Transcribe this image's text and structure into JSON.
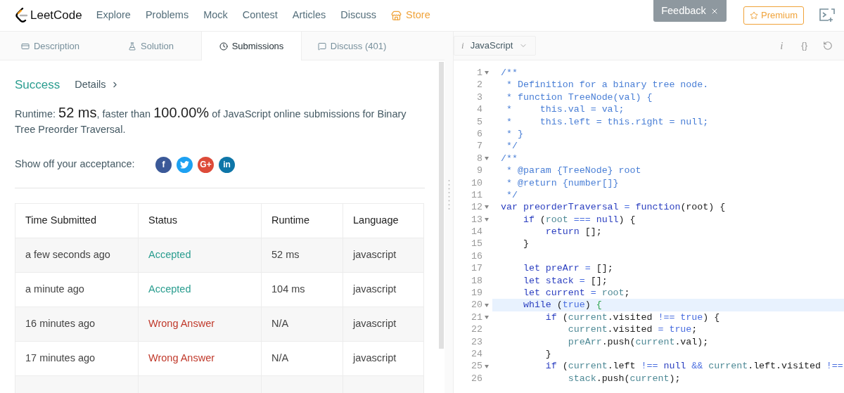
{
  "nav": {
    "logo": "LeetCode",
    "links": [
      {
        "label": "Explore",
        "kind": "link"
      },
      {
        "label": "Problems",
        "kind": "link"
      },
      {
        "label": "Mock",
        "kind": "link"
      },
      {
        "label": "Contest",
        "kind": "link"
      },
      {
        "label": "Articles",
        "kind": "link"
      },
      {
        "label": "Discuss",
        "kind": "link"
      },
      {
        "label": "Store",
        "kind": "store"
      }
    ],
    "feedback": "Feedback",
    "premium": "Premium"
  },
  "tabs": [
    {
      "label": "Description",
      "selected": false
    },
    {
      "label": "Solution",
      "selected": false
    },
    {
      "label": "Submissions",
      "selected": true
    },
    {
      "label": "Discuss (401)",
      "selected": false
    }
  ],
  "result": {
    "status": "Success",
    "details": "Details",
    "summary": [
      {
        "text": "Runtime: ",
        "big": false
      },
      {
        "text": "52 ms",
        "big": true
      },
      {
        "text": ", faster than ",
        "big": false
      },
      {
        "text": "100.00%",
        "big": true
      },
      {
        "text": " of JavaScript online submissions for Binary Tree Preorder Traversal.",
        "big": false
      }
    ],
    "share_label": "Show off your acceptance:",
    "share_buttons": [
      {
        "kind": "facebook",
        "glyph": "f"
      },
      {
        "kind": "twitter"
      },
      {
        "kind": "google",
        "glyph": "G+"
      },
      {
        "kind": "linkedin",
        "glyph": "in"
      }
    ]
  },
  "table": {
    "columns": [
      "Time Submitted",
      "Status",
      "Runtime",
      "Language"
    ],
    "rows": [
      {
        "time": "a few seconds ago",
        "status": "Accepted",
        "kind": "accepted",
        "runtime": "52 ms",
        "language": "javascript"
      },
      {
        "time": "a minute ago",
        "status": "Accepted",
        "kind": "accepted",
        "runtime": "104 ms",
        "language": "javascript"
      },
      {
        "time": "16 minutes ago",
        "status": "Wrong Answer",
        "kind": "wrong",
        "runtime": "N/A",
        "language": "javascript"
      },
      {
        "time": "17 minutes ago",
        "status": "Wrong Answer",
        "kind": "wrong",
        "runtime": "N/A",
        "language": "javascript"
      }
    ]
  },
  "editor": {
    "language_glyph": "i",
    "language": "JavaScript",
    "toolbar": [
      {
        "kind": "info",
        "glyph": "i"
      },
      {
        "kind": "braces",
        "glyph": "{}"
      },
      {
        "kind": "reset"
      }
    ],
    "lines": [
      {
        "n": "1",
        "fold": true,
        "active": false,
        "tokens": [
          {
            "kind": "comment",
            "t": "/**"
          }
        ]
      },
      {
        "n": "2",
        "fold": false,
        "active": false,
        "tokens": [
          {
            "kind": "comment",
            "t": " * Definition for a binary tree node."
          }
        ]
      },
      {
        "n": "3",
        "fold": false,
        "active": false,
        "tokens": [
          {
            "kind": "comment",
            "t": " * function TreeNode(val) {"
          }
        ]
      },
      {
        "n": "4",
        "fold": false,
        "active": false,
        "tokens": [
          {
            "kind": "comment",
            "t": " *     this.val = val;"
          }
        ]
      },
      {
        "n": "5",
        "fold": false,
        "active": false,
        "tokens": [
          {
            "kind": "comment",
            "t": " *     this.left = this.right = null;"
          }
        ]
      },
      {
        "n": "6",
        "fold": false,
        "active": false,
        "tokens": [
          {
            "kind": "comment",
            "t": " * }"
          }
        ]
      },
      {
        "n": "7",
        "fold": false,
        "active": false,
        "tokens": [
          {
            "kind": "comment",
            "t": " */"
          }
        ]
      },
      {
        "n": "8",
        "fold": true,
        "active": false,
        "tokens": [
          {
            "kind": "comment",
            "t": "/**"
          }
        ]
      },
      {
        "n": "9",
        "fold": false,
        "active": false,
        "tokens": [
          {
            "kind": "comment",
            "t": " * @param {TreeNode} root"
          }
        ]
      },
      {
        "n": "10",
        "fold": false,
        "active": false,
        "tokens": [
          {
            "kind": "comment",
            "t": " * @return {number[]}"
          }
        ]
      },
      {
        "n": "11",
        "fold": false,
        "active": false,
        "tokens": [
          {
            "kind": "comment",
            "t": " */"
          }
        ]
      },
      {
        "n": "12",
        "fold": true,
        "active": false,
        "tokens": [
          {
            "kind": "keyword",
            "t": "var preorderTraversal"
          },
          {
            "kind": "operator",
            "t": " ="
          },
          {
            "kind": "keyword",
            "t": " function"
          },
          {
            "kind": "plain",
            "t": "(root) {"
          }
        ]
      },
      {
        "n": "13",
        "fold": true,
        "active": false,
        "tokens": [
          {
            "kind": "keyword",
            "t": "    if"
          },
          {
            "kind": "plain",
            "t": " ("
          },
          {
            "kind": "variable",
            "t": "root"
          },
          {
            "kind": "operator",
            "t": " ==="
          },
          {
            "kind": "keyword",
            "t": " null"
          },
          {
            "kind": "plain",
            "t": ") {"
          }
        ]
      },
      {
        "n": "14",
        "fold": false,
        "active": false,
        "tokens": [
          {
            "kind": "keyword",
            "t": "        return"
          },
          {
            "kind": "plain",
            "t": " [];"
          }
        ]
      },
      {
        "n": "15",
        "fold": false,
        "active": false,
        "tokens": [
          {
            "kind": "plain",
            "t": "    }"
          }
        ]
      },
      {
        "n": "16",
        "fold": false,
        "active": false
      },
      {
        "n": "17",
        "fold": false,
        "active": false,
        "tokens": [
          {
            "kind": "keyword",
            "t": "    let preArr"
          },
          {
            "kind": "operator",
            "t": " ="
          },
          {
            "kind": "plain",
            "t": " [];"
          }
        ]
      },
      {
        "n": "18",
        "fold": false,
        "active": false,
        "tokens": [
          {
            "kind": "keyword",
            "t": "    let stack"
          },
          {
            "kind": "operator",
            "t": " ="
          },
          {
            "kind": "plain",
            "t": " [];"
          }
        ]
      },
      {
        "n": "19",
        "fold": false,
        "active": false,
        "tokens": [
          {
            "kind": "keyword",
            "t": "    let current"
          },
          {
            "kind": "operator",
            "t": " ="
          },
          {
            "kind": "variable",
            "t": " root"
          },
          {
            "kind": "plain",
            "t": ";"
          }
        ]
      },
      {
        "n": "20",
        "fold": true,
        "active": true,
        "tokens": [
          {
            "kind": "keyword",
            "t": "    while"
          },
          {
            "kind": "plain",
            "t": " ("
          },
          {
            "kind": "operator",
            "t": "true"
          },
          {
            "kind": "plain",
            "t": ") "
          },
          {
            "kind": "bracket",
            "t": "{"
          }
        ]
      },
      {
        "n": "21",
        "fold": true,
        "active": false,
        "tokens": [
          {
            "kind": "keyword",
            "t": "        if"
          },
          {
            "kind": "plain",
            "t": " ("
          },
          {
            "kind": "variable",
            "t": "current"
          },
          {
            "kind": "plain",
            "t": ".visited"
          },
          {
            "kind": "operator",
            "t": " !=="
          },
          {
            "kind": "operator",
            "t": " true"
          },
          {
            "kind": "plain",
            "t": ") {"
          }
        ]
      },
      {
        "n": "22",
        "fold": false,
        "active": false,
        "tokens": [
          {
            "kind": "variable",
            "t": "            current"
          },
          {
            "kind": "plain",
            "t": ".visited"
          },
          {
            "kind": "operator",
            "t": " ="
          },
          {
            "kind": "operator",
            "t": " true"
          },
          {
            "kind": "plain",
            "t": ";"
          }
        ]
      },
      {
        "n": "23",
        "fold": false,
        "active": false,
        "tokens": [
          {
            "kind": "variable",
            "t": "            preArr"
          },
          {
            "kind": "plain",
            "t": ".push("
          },
          {
            "kind": "variable",
            "t": "current"
          },
          {
            "kind": "plain",
            "t": ".val);"
          }
        ]
      },
      {
        "n": "24",
        "fold": false,
        "active": false,
        "tokens": [
          {
            "kind": "plain",
            "t": "        }"
          }
        ]
      },
      {
        "n": "25",
        "fold": true,
        "active": false,
        "tokens": [
          {
            "kind": "keyword",
            "t": "        if"
          },
          {
            "kind": "plain",
            "t": " ("
          },
          {
            "kind": "variable",
            "t": "current"
          },
          {
            "kind": "plain",
            "t": ".left"
          },
          {
            "kind": "operator",
            "t": " !=="
          },
          {
            "kind": "keyword",
            "t": " null"
          },
          {
            "kind": "operator",
            "t": " &&"
          },
          {
            "kind": "variable",
            "t": " current"
          },
          {
            "kind": "plain",
            "t": ".left.visited"
          },
          {
            "kind": "operator",
            "t": " !=="
          }
        ]
      },
      {
        "n": "26",
        "fold": false,
        "active": false,
        "tokens": [
          {
            "kind": "variable",
            "t": "            stack"
          },
          {
            "kind": "plain",
            "t": ".push("
          },
          {
            "kind": "variable",
            "t": "current"
          },
          {
            "kind": "plain",
            "t": ");"
          }
        ]
      }
    ]
  }
}
